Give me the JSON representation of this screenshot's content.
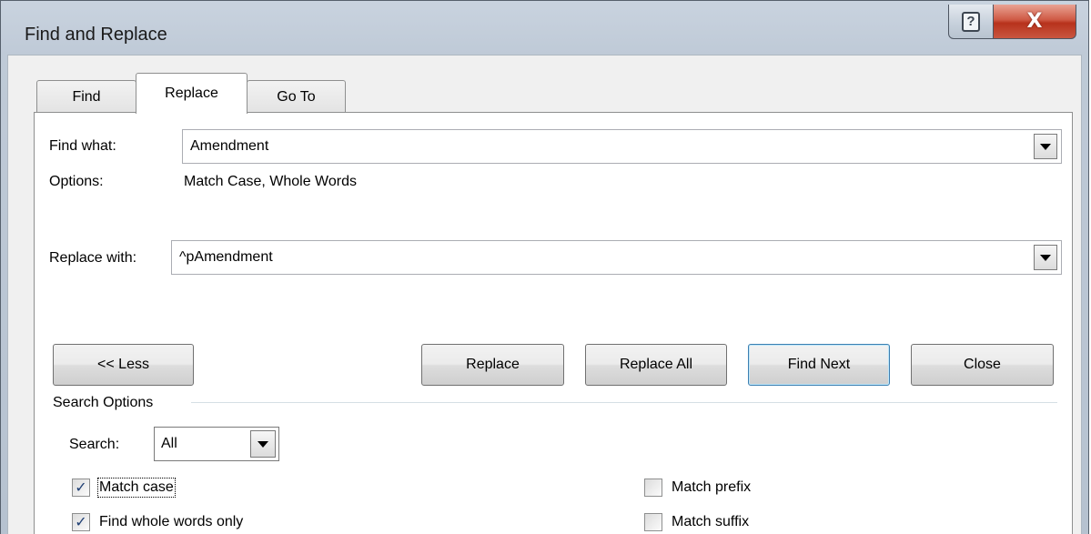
{
  "window": {
    "title": "Find and Replace",
    "help_glyph": "?",
    "close_glyph": "X"
  },
  "tabs": [
    {
      "label": "Find",
      "active": false
    },
    {
      "label": "Replace",
      "active": true
    },
    {
      "label": "Go To",
      "active": false
    }
  ],
  "find": {
    "label": "Find what:",
    "value": "Amendment",
    "options_label": "Options:",
    "options_value": "Match Case, Whole Words"
  },
  "replace": {
    "label": "Replace with:",
    "value": "^pAmendment"
  },
  "buttons": {
    "less": "<< Less",
    "replace": "Replace",
    "replace_all": "Replace All",
    "find_next": "Find Next",
    "close": "Close"
  },
  "search_options": {
    "group_label": "Search Options",
    "search_label": "Search:",
    "search_value": "All",
    "checkboxes": [
      {
        "label": "Match case",
        "checked": true
      },
      {
        "label": "Find whole words only",
        "checked": true
      },
      {
        "label": "Match prefix",
        "checked": false
      },
      {
        "label": "Match suffix",
        "checked": false
      }
    ]
  },
  "colors": {
    "titlebar": "#bfcad7",
    "close_button": "#c9563f",
    "default_button_border": "#3c7fb1",
    "check_mark": "#1f3f74"
  },
  "icons": {
    "help": "help-icon",
    "close": "close-icon",
    "dropdown": "chevron-down-icon",
    "check": "check-icon"
  }
}
